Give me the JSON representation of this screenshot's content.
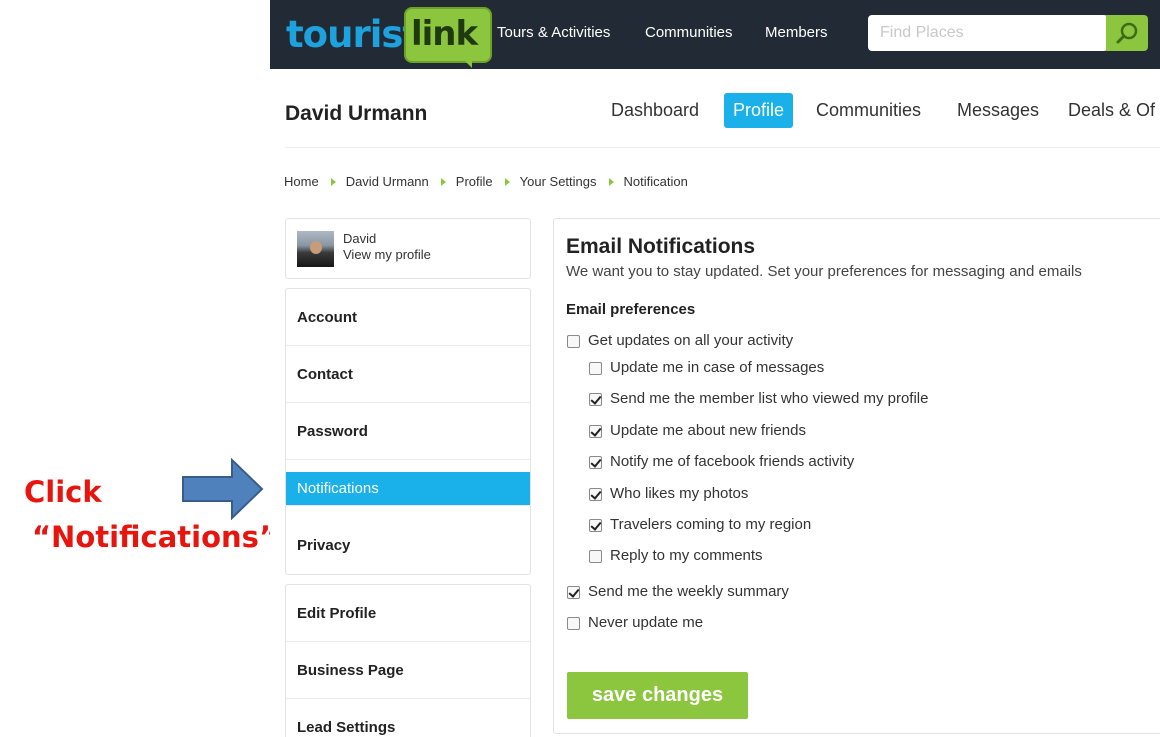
{
  "annotation": {
    "line1": "Click",
    "line2": "“Notifications”"
  },
  "header": {
    "logo_part1": "tourist",
    "logo_part2": "link",
    "nav": [
      "Tours & Activities",
      "Communities",
      "Members"
    ],
    "search_placeholder": "Find Places"
  },
  "profile": {
    "name": "David Urmann",
    "tabs": [
      "Dashboard",
      "Profile",
      "Communities",
      "Messages",
      "Deals & Of"
    ],
    "active_tab": "Profile"
  },
  "breadcrumb": [
    "Home",
    "David Urmann",
    "Profile",
    "Your Settings",
    "Notification"
  ],
  "sidebar": {
    "user_name": "David",
    "user_link": "View my profile",
    "menu1": [
      "Account",
      "Contact",
      "Password",
      "Notifications",
      "Privacy"
    ],
    "menu2": [
      "Edit Profile",
      "Business Page",
      "Lead Settings"
    ],
    "active_item": "Notifications"
  },
  "panel": {
    "title": "Email Notifications",
    "subtitle": "We want you to stay updated. Set your preferences for messaging and emails",
    "section": "Email preferences",
    "options": [
      {
        "label": "Get updates on all your activity",
        "checked": false
      },
      {
        "label": "Update me in case of messages",
        "checked": false
      },
      {
        "label": "Send me the member list who viewed my profile",
        "checked": true
      },
      {
        "label": "Update me about new friends",
        "checked": true
      },
      {
        "label": "Notify me of facebook friends activity",
        "checked": true
      },
      {
        "label": "Who likes my photos",
        "checked": true
      },
      {
        "label": "Travelers coming to my region",
        "checked": true
      },
      {
        "label": "Reply to my comments",
        "checked": false
      },
      {
        "label": "Send me the weekly summary",
        "checked": true
      },
      {
        "label": "Never update me",
        "checked": false
      }
    ],
    "save_label": "save changes"
  },
  "colors": {
    "brand_blue": "#1ab0ea",
    "brand_green": "#8cc63f",
    "topbar": "#222a35",
    "annotation_red": "#e8140e",
    "arrow_blue": "#4f81bd"
  }
}
